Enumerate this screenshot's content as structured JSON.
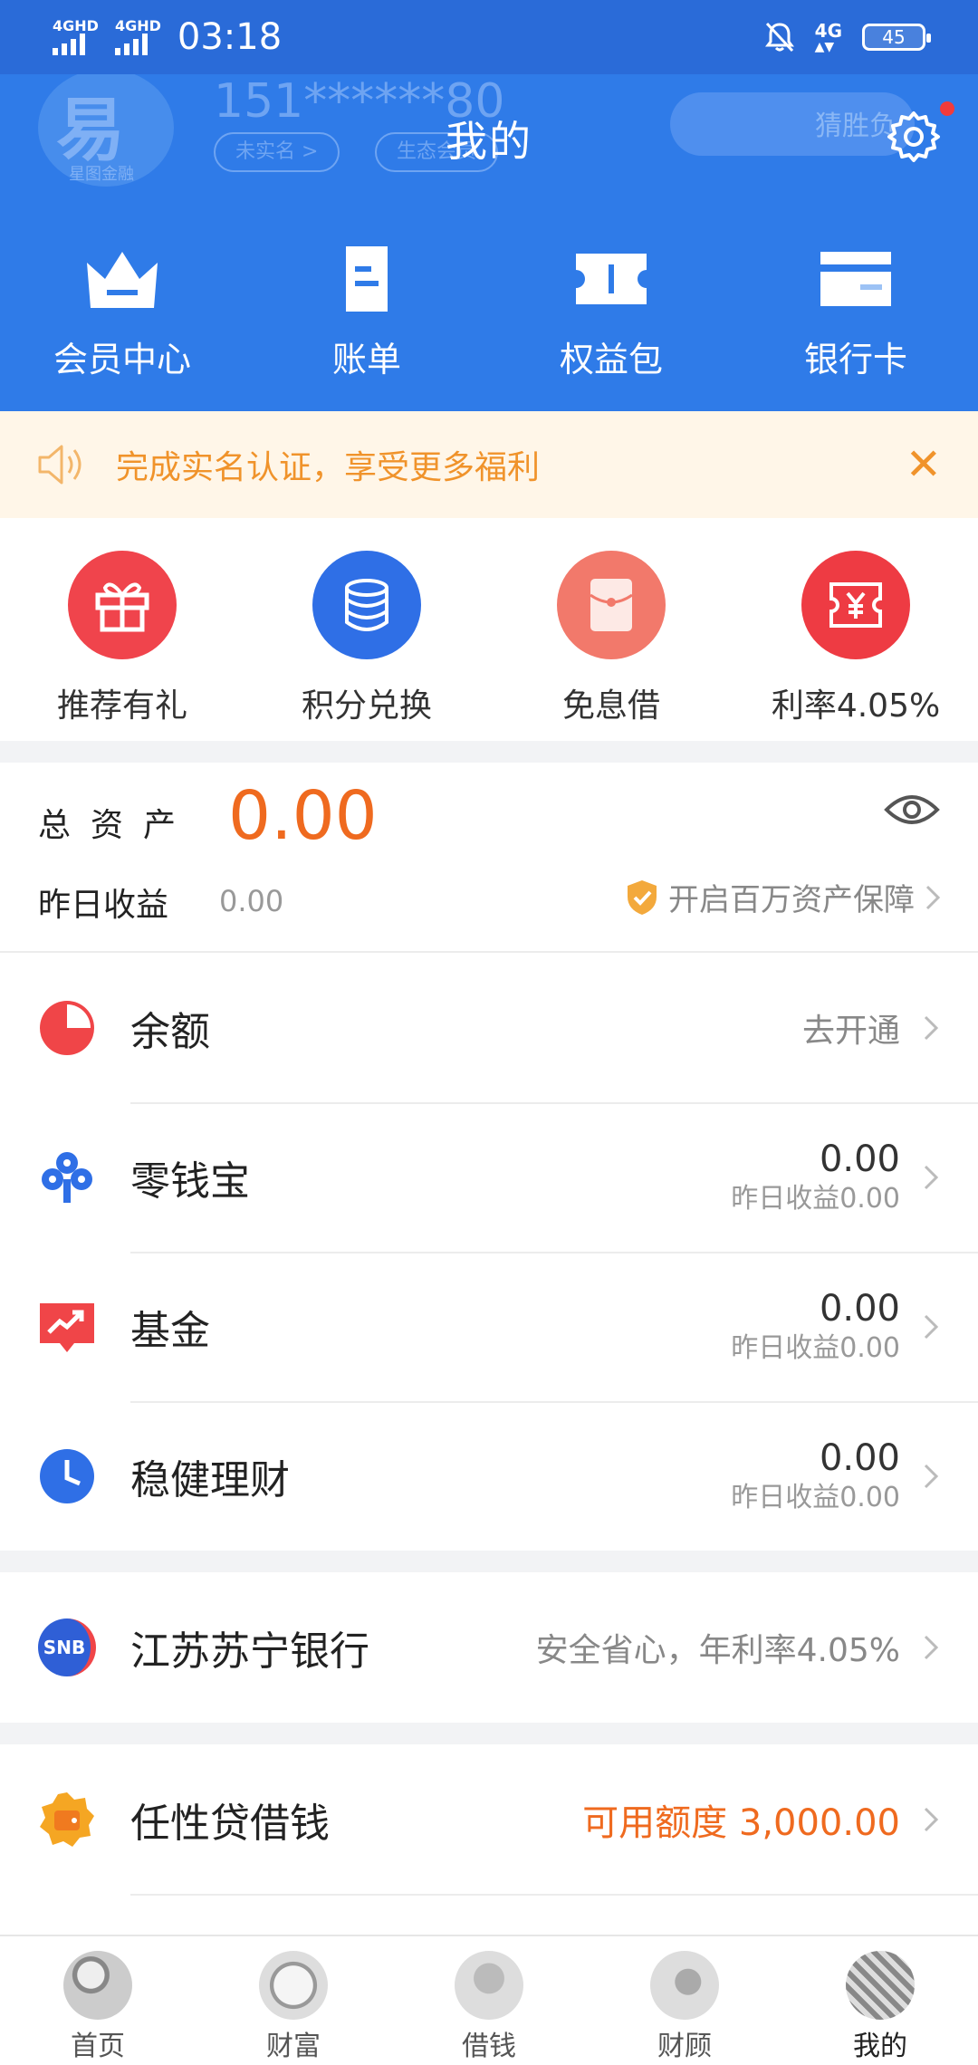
{
  "status_bar": {
    "sim1": "4GHD",
    "sim2": "4GHD",
    "time": "03:18",
    "network": "4G",
    "battery": "45"
  },
  "header": {
    "title": "我的",
    "ghost_phone": "151******80",
    "ghost_tag1": "未实名 >",
    "ghost_tag2": "生态会员",
    "ghost_logo_char": "易",
    "ghost_logo_sub": "星图金融",
    "ghost_banner": "猜胜负"
  },
  "quick_nav": [
    {
      "label": "会员中心",
      "icon": "crown-icon"
    },
    {
      "label": "账单",
      "icon": "bill-icon"
    },
    {
      "label": "权益包",
      "icon": "ticket-icon"
    },
    {
      "label": "银行卡",
      "icon": "card-icon"
    }
  ],
  "notice": {
    "text": "完成实名认证，享受更多福利",
    "close": "✕"
  },
  "promos": [
    {
      "label": "推荐有礼",
      "icon": "gift-icon",
      "color": "#f0444c"
    },
    {
      "label": "积分兑换",
      "icon": "coins-icon",
      "color": "#2f6fe6"
    },
    {
      "label": "免息借",
      "icon": "red-envelope-icon",
      "color": "#f2796b"
    },
    {
      "label": "利率4.05%",
      "icon": "yuan-ticket-icon",
      "color": "#ee3b43"
    }
  ],
  "assets": {
    "label": "总资产",
    "total": "0.00",
    "yesterday_label": "昨日收益",
    "yesterday_value": "0.00",
    "protect_text": "开启百万资产保障"
  },
  "accounts": [
    {
      "name": "余额",
      "icon": "pie-icon",
      "link": "去开通"
    },
    {
      "name": "零钱宝",
      "icon": "clover-icon",
      "amount": "0.00",
      "sub": "昨日收益0.00"
    },
    {
      "name": "基金",
      "icon": "trend-icon",
      "amount": "0.00",
      "sub": "昨日收益0.00"
    },
    {
      "name": "稳健理财",
      "icon": "clock-icon",
      "amount": "0.00",
      "sub": "昨日收益0.00"
    }
  ],
  "bank": {
    "name": "江苏苏宁银行",
    "badge": "SNB",
    "desc": "安全省心，年利率4.05%"
  },
  "loan": {
    "name": "任性贷借钱",
    "amount": "可用额度 3,000.00"
  },
  "tabs": [
    {
      "label": "首页"
    },
    {
      "label": "财富"
    },
    {
      "label": "借钱"
    },
    {
      "label": "财顾"
    },
    {
      "label": "我的",
      "active": true
    }
  ]
}
